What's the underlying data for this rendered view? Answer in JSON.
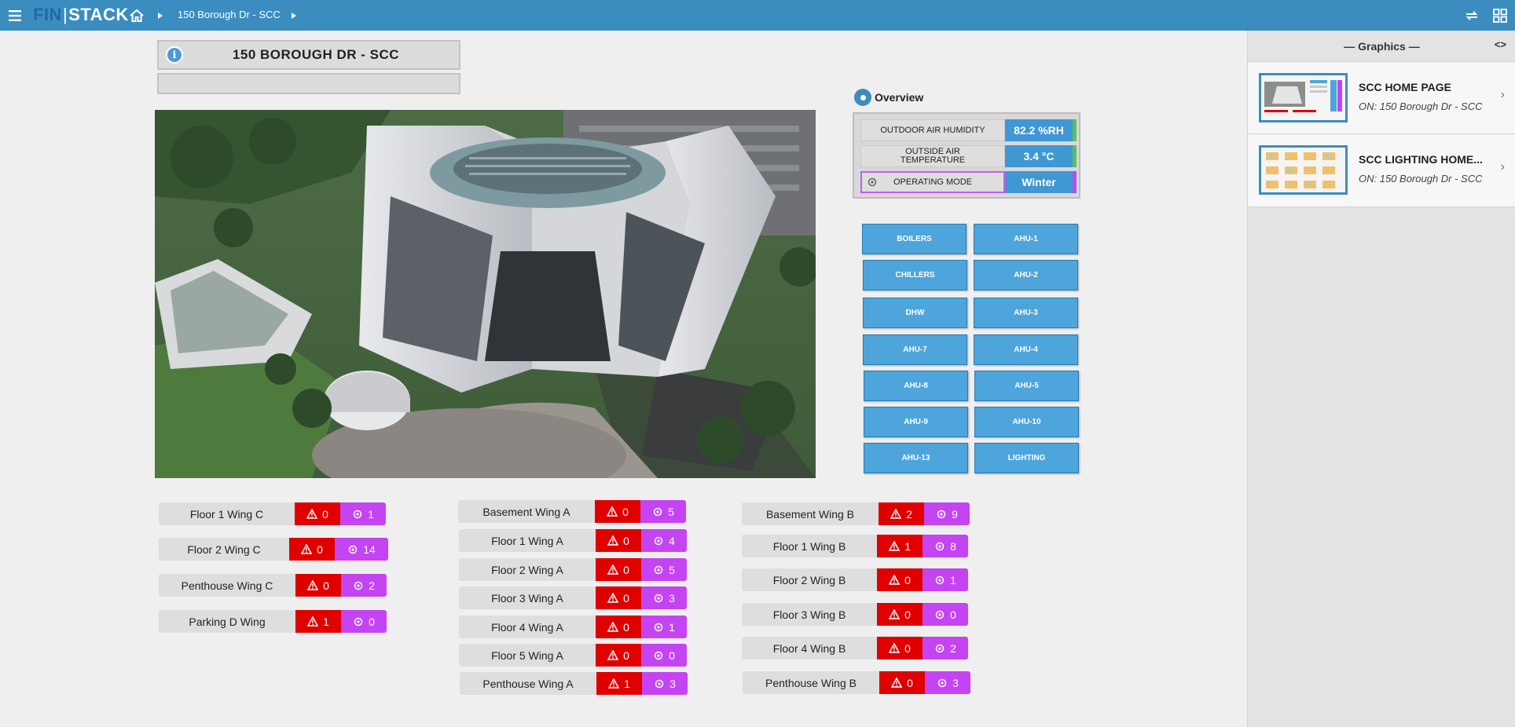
{
  "topbar": {
    "logo_left": "FIN",
    "logo_sep": "|",
    "logo_right": "STACK",
    "breadcrumb": "150 Borough Dr - SCC"
  },
  "site": {
    "title": "150 BOROUGH DR - SCC",
    "subtitle": ""
  },
  "overview": {
    "label": "Overview",
    "rows": [
      {
        "label": "OUTDOOR AIR HUMIDITY",
        "value": "82.2 %RH"
      },
      {
        "label": "OUTSIDE AIR TEMPERATURE",
        "value": "3.4 °C"
      },
      {
        "label": "OPERATING MODE",
        "value": "Winter"
      }
    ]
  },
  "equipment": [
    "BOILERS",
    "AHU-1",
    "CHILLERS",
    "AHU-2",
    "DHW",
    "AHU-3",
    "AHU-7",
    "AHU-4",
    "AHU-8",
    "AHU-5",
    "AHU-9",
    "AHU-10",
    "AHU-13",
    "LIGHTING"
  ],
  "zones": {
    "col1": [
      {
        "name": "Floor 1 Wing C",
        "alarms": "0",
        "overrides": "1"
      },
      {
        "name": "Floor 2 Wing C",
        "alarms": "0",
        "overrides": "14"
      },
      {
        "name": "Penthouse Wing C",
        "alarms": "0",
        "overrides": "2"
      },
      {
        "name": "Parking D Wing",
        "alarms": "1",
        "overrides": "0"
      }
    ],
    "col2": [
      {
        "name": "Basement Wing A",
        "alarms": "0",
        "overrides": "5"
      },
      {
        "name": "Floor 1 Wing A",
        "alarms": "0",
        "overrides": "4"
      },
      {
        "name": "Floor 2 Wing A",
        "alarms": "0",
        "overrides": "5"
      },
      {
        "name": "Floor 3 Wing A",
        "alarms": "0",
        "overrides": "3"
      },
      {
        "name": "Floor 4 Wing A",
        "alarms": "0",
        "overrides": "1"
      },
      {
        "name": "Floor 5 Wing A",
        "alarms": "0",
        "overrides": "0"
      },
      {
        "name": "Penthouse Wing A",
        "alarms": "1",
        "overrides": "3"
      }
    ],
    "col3": [
      {
        "name": "Basement Wing B",
        "alarms": "2",
        "overrides": "9"
      },
      {
        "name": "Floor 1 Wing B",
        "alarms": "1",
        "overrides": "8"
      },
      {
        "name": "Floor 2 Wing B",
        "alarms": "0",
        "overrides": "1"
      },
      {
        "name": "Floor 3 Wing B",
        "alarms": "0",
        "overrides": "0"
      },
      {
        "name": "Floor 4 Wing B",
        "alarms": "0",
        "overrides": "2"
      },
      {
        "name": "Penthouse Wing B",
        "alarms": "0",
        "overrides": "3"
      }
    ]
  },
  "panel": {
    "title": "— Graphics —",
    "cards": [
      {
        "title": "SCC HOME PAGE",
        "subtitle": "ON: 150 Borough Dr - SCC"
      },
      {
        "title": "SCC LIGHTING HOME...",
        "subtitle": "ON: 150 Borough Dr - SCC"
      }
    ]
  },
  "colors": {
    "topbar": "#3b8dbf",
    "alarm": "#e00000",
    "override": "#c444f2",
    "button": "#4ea5db"
  },
  "icons": [
    "menu-icon",
    "home-icon",
    "chevron-right-icon",
    "sync-icon",
    "apps-grid-icon",
    "info-icon",
    "location-pin-icon",
    "gear-icon",
    "warning-icon",
    "panel-toggle-icon"
  ]
}
